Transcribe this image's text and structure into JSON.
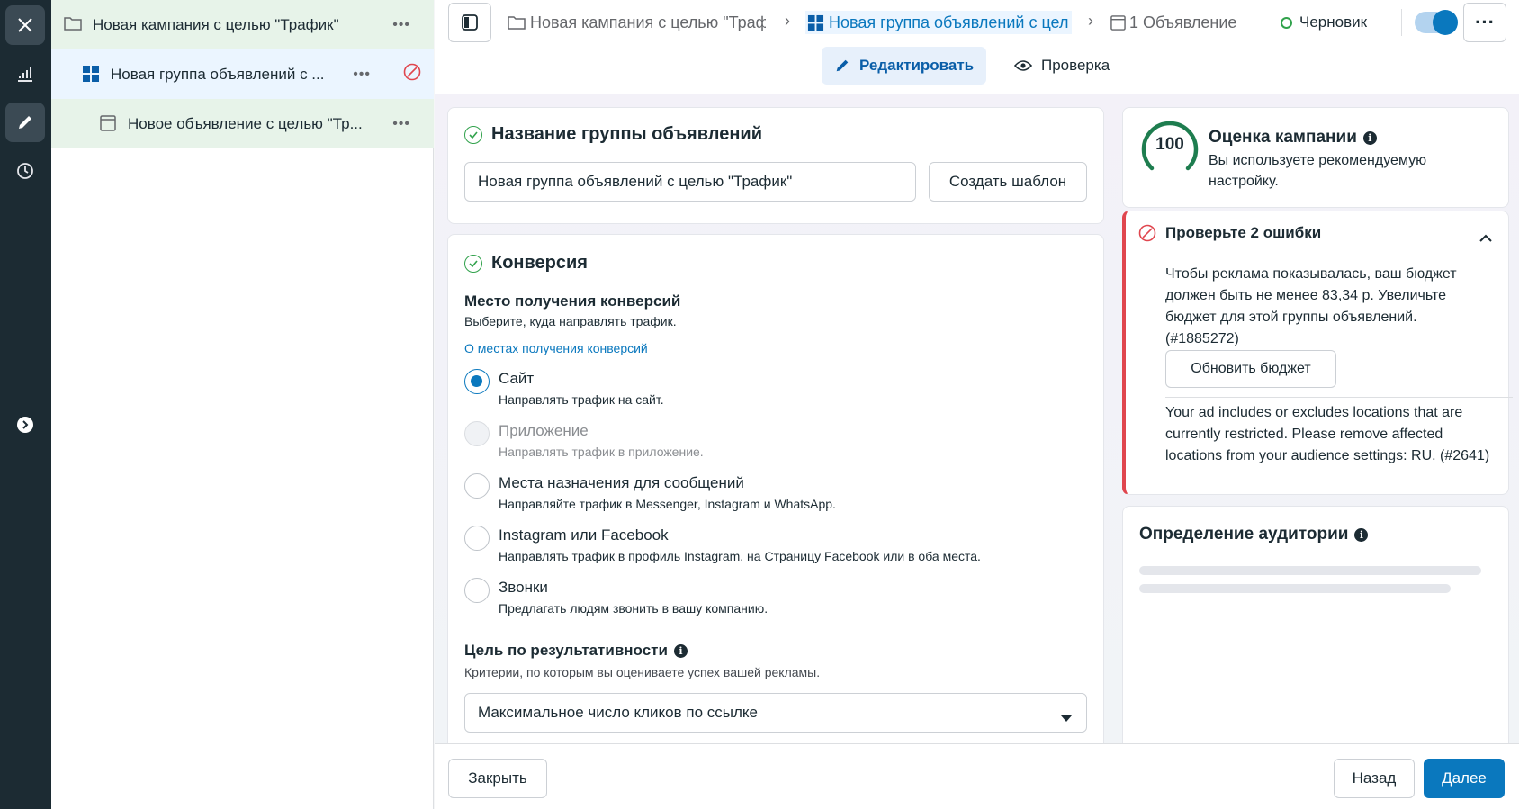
{
  "tree": {
    "campaign": "Новая кампания с целью \"Трафик\"",
    "adset": "Новая группа объявлений с ...",
    "ad": "Новое объявление с целью \"Тр...",
    "more": "•••"
  },
  "breadcrumb": {
    "campaign": "Новая кампания с целью \"Траф",
    "adset": "Новая группа объявлений с цел",
    "ad": "1 Объявление",
    "status": "Черновик",
    "more": "···"
  },
  "mode_tabs": {
    "edit": "Редактировать",
    "review": "Проверка"
  },
  "adset_name": {
    "title": "Название группы объявлений",
    "value": "Новая группа объявлений с целью \"Трафик\"",
    "template_button": "Создать шаблон"
  },
  "conversion": {
    "title": "Конверсия",
    "location_title": "Место получения конверсий",
    "location_desc": "Выберите, куда направлять трафик.",
    "link": "О местах получения конверсий",
    "options": [
      {
        "label": "Сайт",
        "desc": "Направлять трафик на сайт."
      },
      {
        "label": "Приложение",
        "desc": "Направлять трафик в приложение."
      },
      {
        "label": "Места назначения для сообщений",
        "desc": "Направляйте трафик в Messenger, Instagram и WhatsApp."
      },
      {
        "label": "Instagram или Facebook",
        "desc": "Направлять трафик в профиль Instagram, на Страницу Facebook или в оба места."
      },
      {
        "label": "Звонки",
        "desc": "Предлагать людям звонить в вашу компанию."
      }
    ],
    "selected": "Сайт",
    "goal_title": "Цель по результативности",
    "goal_desc": "Критерии, по которым вы оцениваете успех вашей рекламы.",
    "goal_value": "Максимальное число кликов по ссылке"
  },
  "score": {
    "value": "100",
    "title": "Оценка кампании",
    "desc": "Вы используете рекомендуемую настройку."
  },
  "errors": {
    "title": "Проверьте 2 ошибки",
    "error1": "Чтобы реклама показывалась, ваш бюджет должен быть не менее 83,34 р. Увеличьте бюджет для этой группы объявлений. (#1885272)",
    "update_button": "Обновить бюджет",
    "error2": "Your ad includes or excludes locations that are currently restricted. Please remove affected locations from your audience settings: RU. (#2641)"
  },
  "audience": {
    "title": "Определение аудитории"
  },
  "footer": {
    "close": "Закрыть",
    "back": "Назад",
    "next": "Далее"
  },
  "colors": {
    "accent": "#0a78be",
    "success": "#31a24c",
    "error": "#e0464e",
    "rail": "#1c2b33"
  }
}
